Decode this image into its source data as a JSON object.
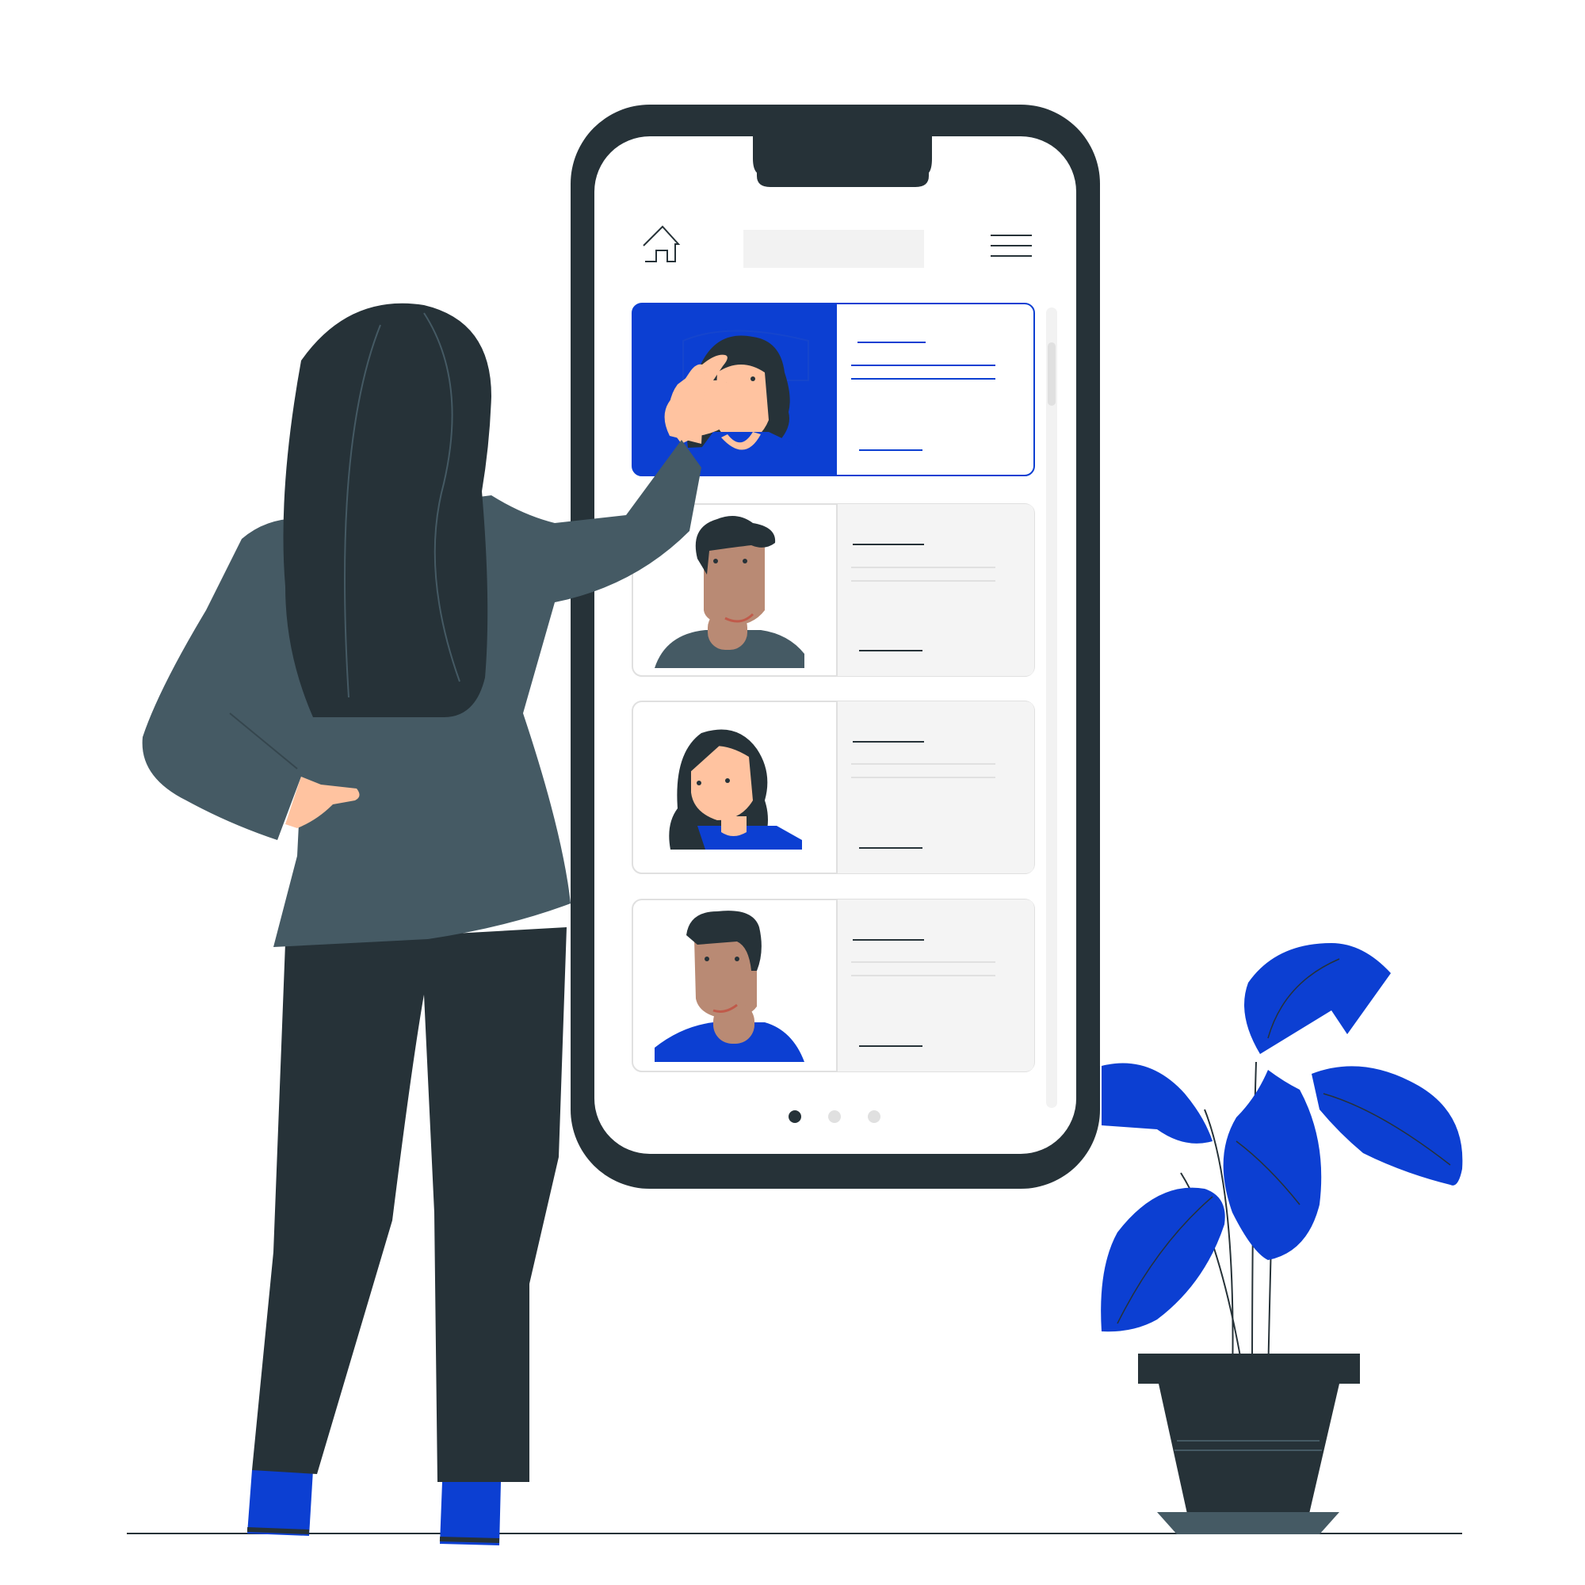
{
  "colors": {
    "phone_frame": "#263238",
    "screen": "#ffffff",
    "accent_blue": "#0c3fd2",
    "card_bg": "#f4f4f4",
    "card_border": "#e0e0e0",
    "jacket": "#455a64",
    "hair": "#263238",
    "skin_light": "#ffc3a0",
    "skin_dark": "#b98a74",
    "shirt_gray": "#455a64",
    "plant_pot": "#263238",
    "plant_tray": "#455a64"
  },
  "phone": {
    "header": {
      "home_icon": "home-icon",
      "menu_icon": "hamburger-menu-icon"
    },
    "cards": [
      {
        "avatar": "woman-long-hair",
        "selected": true
      },
      {
        "avatar": "man-gray-shirt",
        "selected": false
      },
      {
        "avatar": "woman-blue-shirt",
        "selected": false
      },
      {
        "avatar": "man-blue-shirt",
        "selected": false
      }
    ],
    "pagination": {
      "total_pages": 3,
      "current_page": 1
    }
  }
}
